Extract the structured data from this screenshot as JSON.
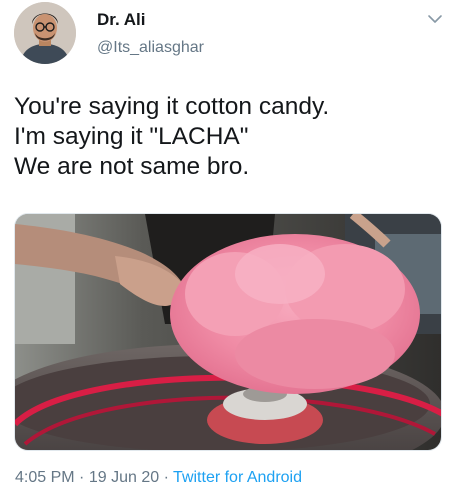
{
  "author": {
    "display_name": "Dr. Ali",
    "handle": "@Its_aliasghar",
    "avatar_icon": "profile-photo"
  },
  "tweet": {
    "lines": [
      "You're saying it cotton candy.",
      "I'm saying it \"LACHA\"",
      "We are not same bro."
    ],
    "media_icon": "cotton-candy-photo"
  },
  "meta": {
    "time": "4:05 PM",
    "separator": "·",
    "date": "19 Jun 20",
    "source": "Twitter for Android"
  },
  "colors": {
    "text": "#14171a",
    "secondary": "#657786",
    "link": "#1da1f2",
    "candy_pink": "#f08ca6"
  }
}
